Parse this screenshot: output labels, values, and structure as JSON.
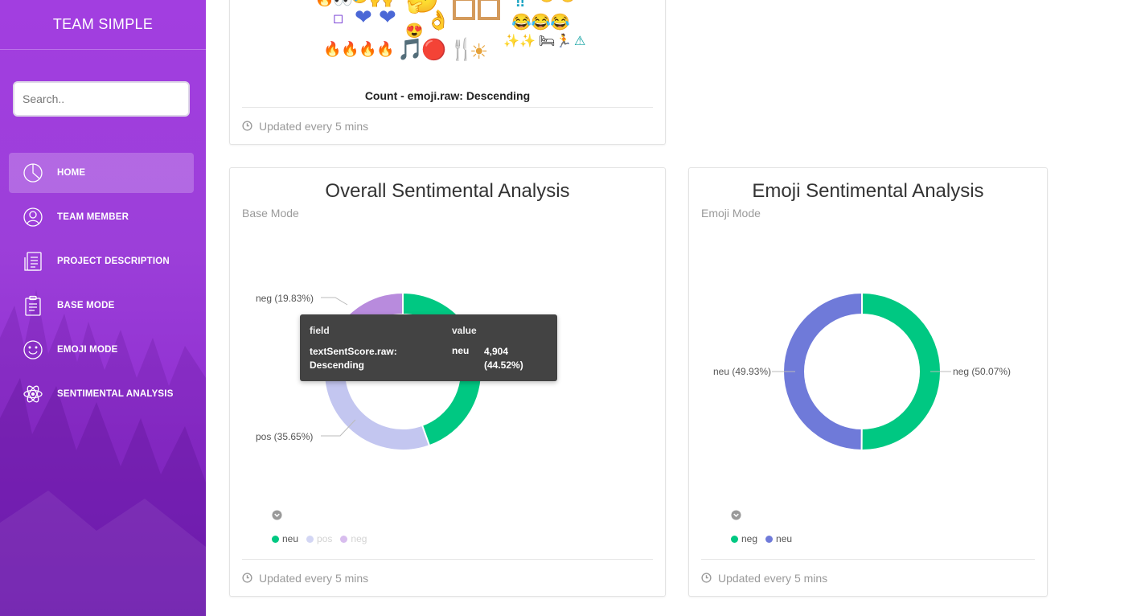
{
  "app": {
    "brand": "TEAM SIMPLE"
  },
  "search": {
    "placeholder": "Search.."
  },
  "sidebar": {
    "items": [
      {
        "label": "HOME",
        "icon": "pie-chart-icon",
        "active": true
      },
      {
        "label": "TEAM MEMBER",
        "icon": "user-icon",
        "active": false
      },
      {
        "label": "PROJECT DESCRIPTION",
        "icon": "document-icon",
        "active": false
      },
      {
        "label": "BASE MODE",
        "icon": "clipboard-icon",
        "active": false
      },
      {
        "label": "EMOJI MODE",
        "icon": "smiley-icon",
        "active": false
      },
      {
        "label": "SENTIMENTAL ANALYSIS",
        "icon": "atom-icon",
        "active": false
      }
    ]
  },
  "emoji_card": {
    "caption": "Count - emoji.raw: Descending",
    "footer": "Updated every 5 mins"
  },
  "overall_card": {
    "title": "Overall Sentimental Analysis",
    "subtitle": "Base Mode",
    "footer": "Updated every 5 mins",
    "slice_labels": {
      "neg": "neg (19.83%)",
      "pos": "pos (35.65%)"
    },
    "legend": [
      {
        "label": "neu",
        "color": "#00c882",
        "muted": false
      },
      {
        "label": "pos",
        "color": "#c6c9f0",
        "muted": true
      },
      {
        "label": "neg",
        "color": "#c9a0e6",
        "muted": true
      }
    ],
    "tooltip": {
      "field_header": "field",
      "value_header": "value",
      "field": "textSentScore.raw: Descending",
      "value": "neu",
      "count": "4,904 (44.52%)"
    }
  },
  "emoji_sent_card": {
    "title": "Emoji Sentimental Analysis",
    "subtitle": "Emoji Mode",
    "footer": "Updated every 5 mins",
    "slice_labels": {
      "neu": "neu (49.93%)",
      "neg": "neg (50.07%)"
    },
    "legend": [
      {
        "label": "neg",
        "color": "#00c882",
        "muted": false
      },
      {
        "label": "neu",
        "color": "#6f7ad9",
        "muted": false
      }
    ]
  },
  "chart_data": [
    {
      "type": "pie",
      "title": "Overall Sentimental Analysis",
      "subtitle": "Base Mode",
      "categories": [
        "neu",
        "pos",
        "neg"
      ],
      "values": [
        44.52,
        35.65,
        19.83
      ],
      "colors": [
        "#00c882",
        "#c3c6f0",
        "#b88bdd"
      ],
      "donut": true,
      "legend": "bottom-left"
    },
    {
      "type": "pie",
      "title": "Emoji Sentimental Analysis",
      "subtitle": "Emoji Mode",
      "categories": [
        "neg",
        "neu"
      ],
      "values": [
        50.07,
        49.93
      ],
      "colors": [
        "#00c882",
        "#6f7ad9"
      ],
      "donut": true,
      "legend": "bottom-left"
    }
  ]
}
